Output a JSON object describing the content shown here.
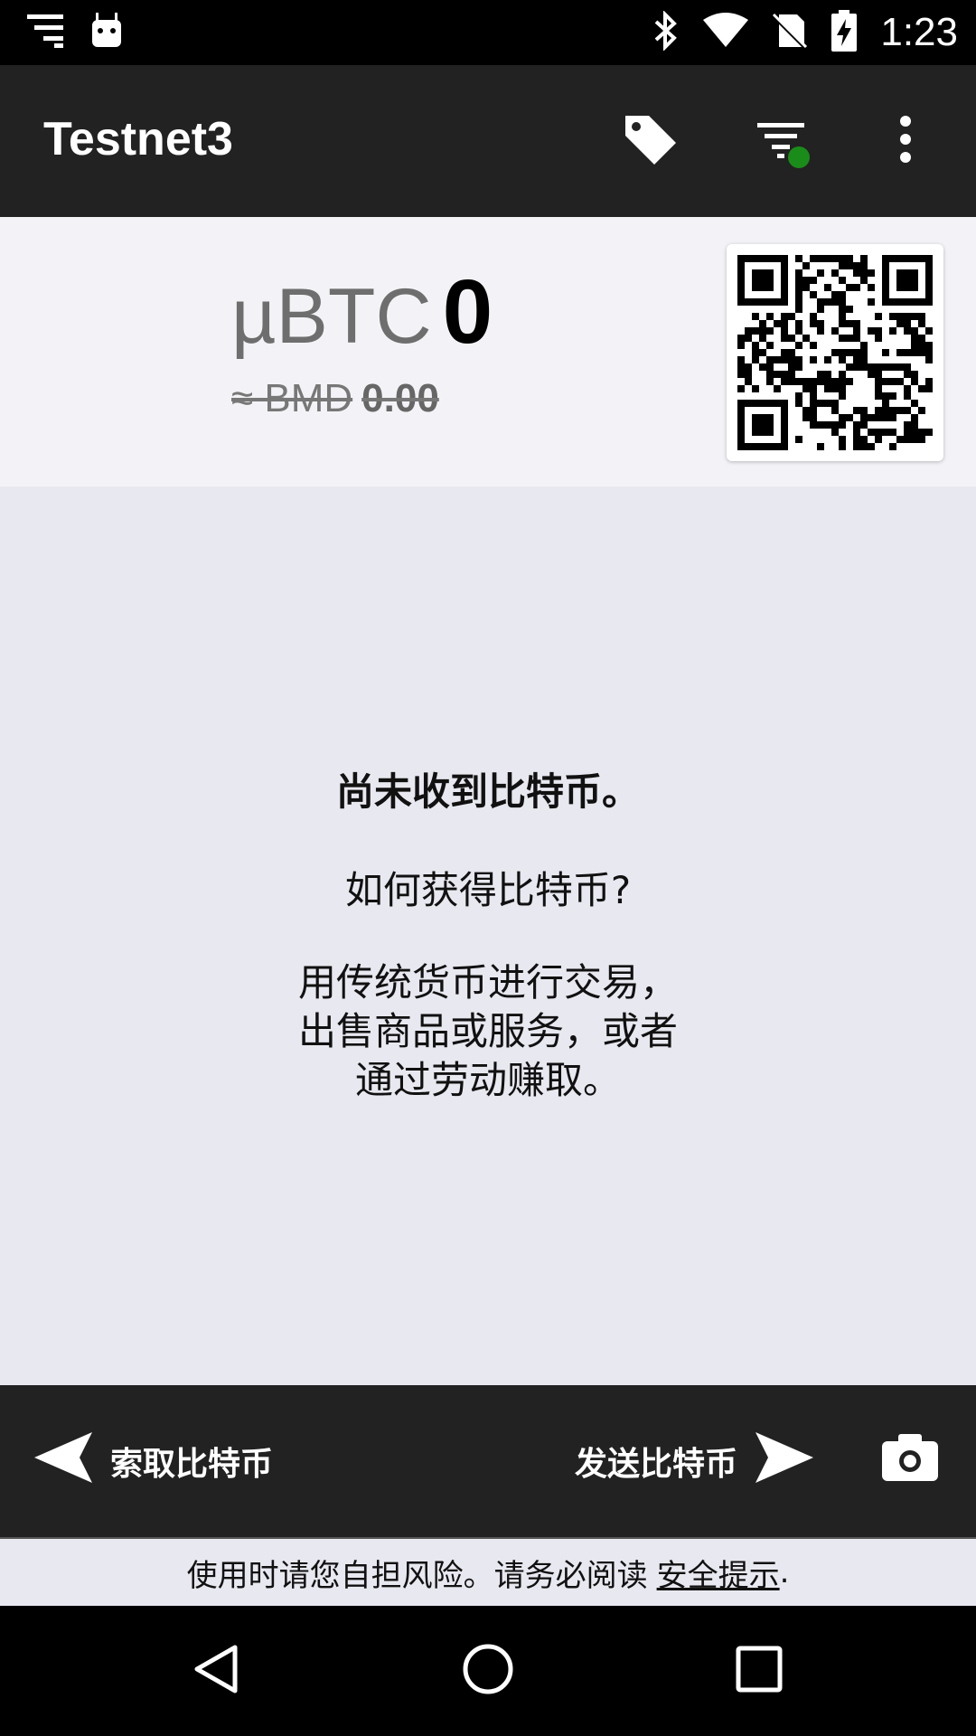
{
  "status_bar": {
    "time": "1:23",
    "icons": [
      "notification-lines-icon",
      "android-icon",
      "bluetooth-icon",
      "wifi-icon",
      "no-sim-icon",
      "battery-charging-icon"
    ]
  },
  "app_bar": {
    "title": "Testnet3",
    "actions": [
      "label-tag-icon",
      "filter-icon",
      "more-vert-icon"
    ],
    "filter_dot_color": "#1a8c1a"
  },
  "balance": {
    "unit": "µBTC",
    "amount": "0",
    "fiat_prefix": "≈ BMD",
    "fiat_amount": "0.00"
  },
  "empty_state": {
    "title": "尚未收到比特币。",
    "question": "如何获得比特币?",
    "body": "用传统货币进行交易，\n出售商品或服务，或者\n通过劳动赚取。"
  },
  "bottom_bar": {
    "request_label": "索取比特币",
    "send_label": "发送比特币"
  },
  "disclaimer": {
    "text": "使用时请您自担风险。请务必阅读",
    "link": "安全提示",
    "suffix": "."
  }
}
